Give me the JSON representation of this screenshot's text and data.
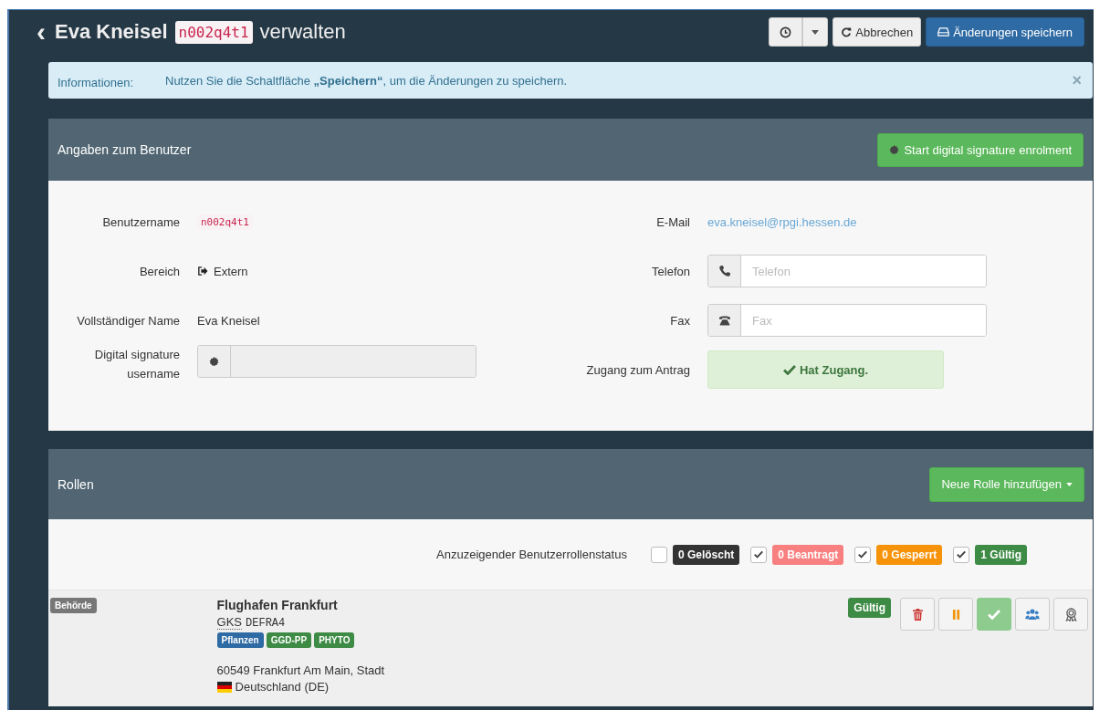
{
  "header": {
    "back_icon": "‹",
    "name": "Eva Kneisel",
    "username": "n002q4t1",
    "suffix": "verwalten",
    "buttons": [
      {
        "kind": "history"
      },
      {
        "kind": "dropdown"
      },
      {
        "kind": "cancel",
        "label": "Abbrechen"
      },
      {
        "kind": "save",
        "label": "Änderungen speichern"
      }
    ]
  },
  "alert": {
    "label": "Informationen:",
    "message": "Nutzen Sie die Schaltfläche **„Speichern“**, um die Änderungen zu speichern.",
    "close": "×"
  },
  "user_panel": {
    "title": "Angaben zum Benutzer",
    "enrol_button": "Start digital signature enrolment",
    "fields": [
      {
        "label": "Benutzername",
        "kind": "code",
        "value": "n002q4t1"
      },
      {
        "label": "E-Mail",
        "kind": "link",
        "value": "eva.kneisel@rpgi.hessen.de"
      },
      {
        "label": "Bereich",
        "kind": "external",
        "value": "Extern"
      },
      {
        "label": "Telefon",
        "kind": "phone",
        "placeholder": "Telefon"
      },
      {
        "label": "Vollständiger Name",
        "kind": "text",
        "value": "Eva Kneisel"
      },
      {
        "label": "Fax",
        "kind": "fax",
        "placeholder": "Fax"
      },
      {
        "label": "Digital signature username",
        "kind": "signature",
        "disabled": true
      },
      {
        "label": "Zugang zum Antrag",
        "kind": "access",
        "value": "Hat Zugang."
      }
    ]
  },
  "roles_panel": {
    "title": "Rollen",
    "add_button": "Neue Rolle hinzufügen",
    "status_label": "Anzuzeigender Benutzerrollenstatus",
    "filters": [
      {
        "label": "0 Gelöscht",
        "checked": false,
        "color": "#333333"
      },
      {
        "label": "0 Beantragt",
        "checked": true,
        "color": "#f98080"
      },
      {
        "label": "0 Gesperrt",
        "checked": true,
        "color": "#f7930a"
      },
      {
        "label": "1 Gültig",
        "checked": true,
        "color": "#3d8b45"
      }
    ],
    "roles": [
      {
        "type": "Behörde",
        "name": "Flughafen Frankfurt",
        "code_label": "GKS",
        "code": "DEFRA4",
        "tags": [
          {
            "label": "Pflanzen",
            "color": "#2e6aa3"
          },
          {
            "label": "GGD-PP",
            "color": "#3d8b45"
          },
          {
            "label": "PHYTO",
            "color": "#3d8b45"
          }
        ],
        "address": "60549 Frankfurt Am Main, Stadt",
        "country": "Deutschland (DE)",
        "status": "Gültig",
        "actions": [
          {
            "kind": "delete",
            "active": false
          },
          {
            "kind": "suspend",
            "active": false
          },
          {
            "kind": "validate",
            "active": true
          },
          {
            "kind": "users",
            "active": false
          },
          {
            "kind": "certificate",
            "active": false
          }
        ]
      }
    ]
  }
}
